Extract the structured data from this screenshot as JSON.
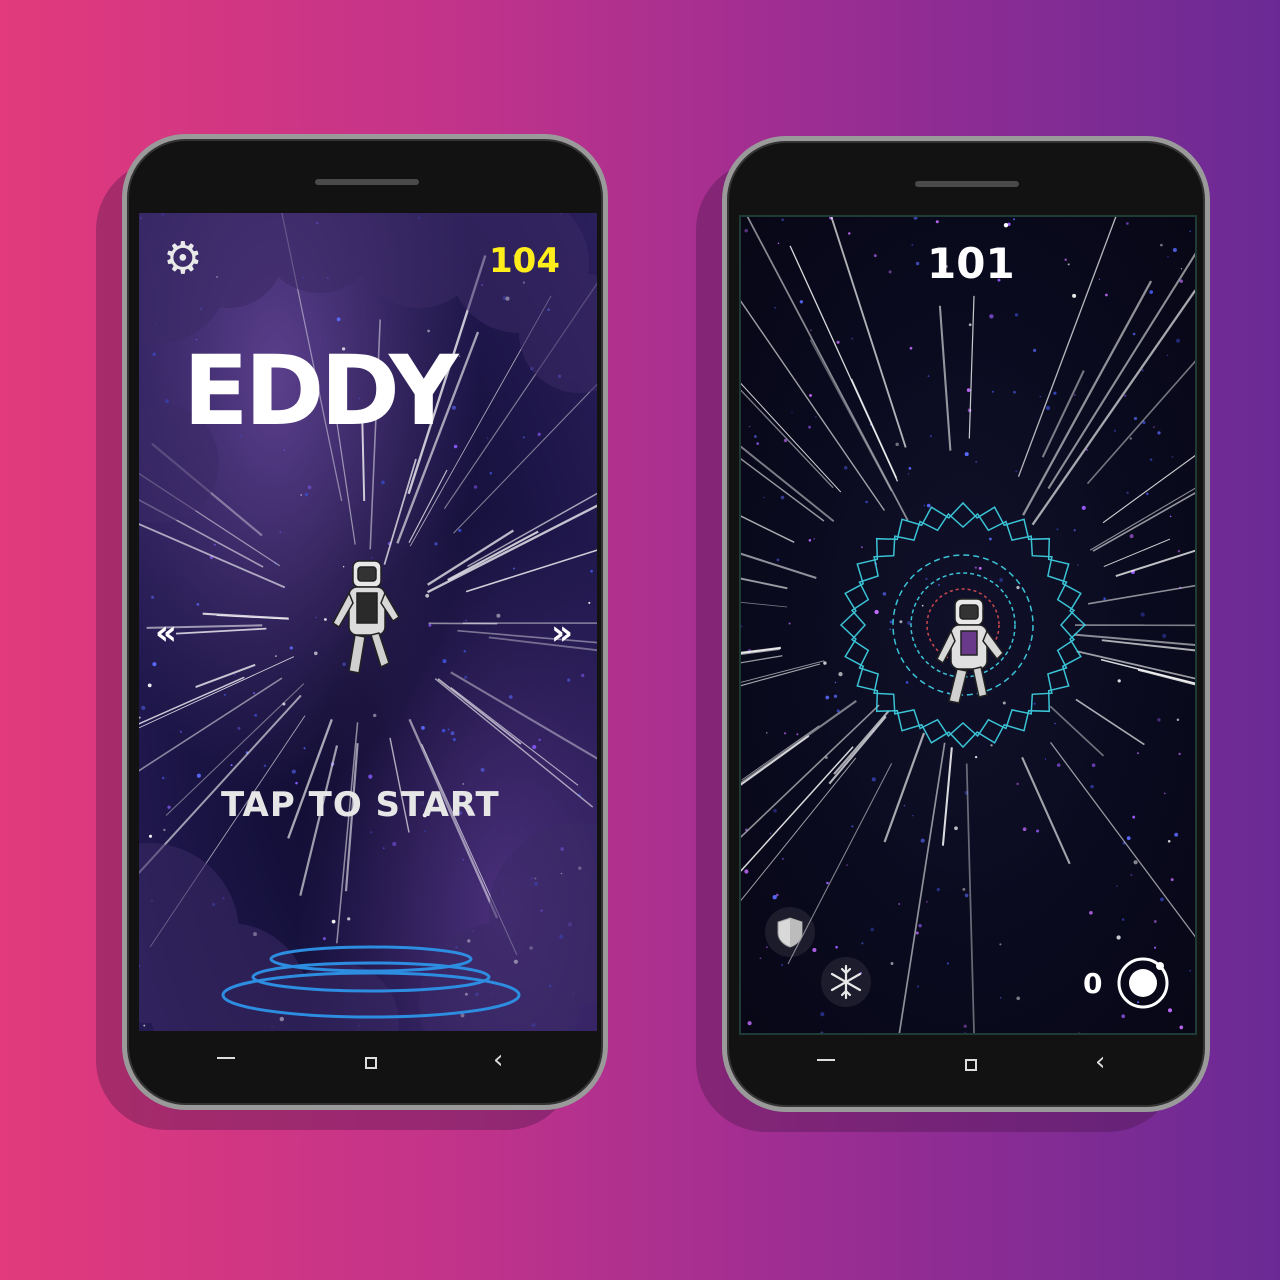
{
  "colors": {
    "bg_left": "#e23a7c",
    "bg_right": "#6a2a95",
    "score_yellow": "#ffee1a",
    "ring_blue": "#2d8de0",
    "ring_cyan": "#3fd7e8"
  },
  "menu_screen": {
    "settings_icon": "gear-icon",
    "best_score": "104",
    "title": "EDDY",
    "prev_icon": "double-chevron-left-icon",
    "prev_glyph": "«",
    "next_icon": "double-chevron-right-icon",
    "next_glyph": "»",
    "start_prompt": "TAP TO START",
    "character": "astronaut"
  },
  "game_screen": {
    "score": "101",
    "shield_icon": "shield-icon",
    "freeze_icon": "snowflake-icon",
    "coin_count": "0",
    "coin_icon": "orbit-coin-icon",
    "character": "astronaut"
  },
  "navbar": {
    "recent_icon": "recent-apps-icon",
    "home_icon": "home-icon",
    "back_icon": "back-icon",
    "back_glyph": "‹"
  }
}
